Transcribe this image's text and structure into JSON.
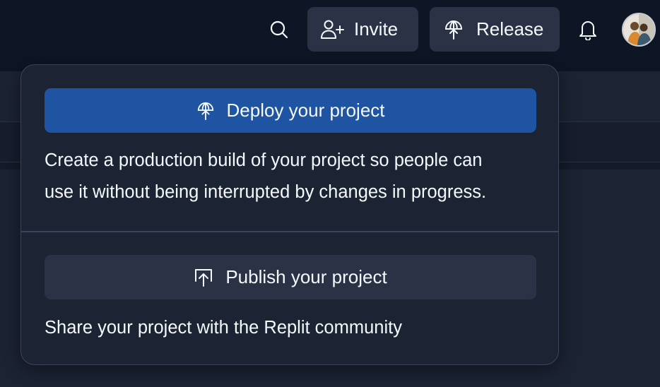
{
  "header": {
    "invite_label": "Invite",
    "release_label": "Release",
    "search_icon": "search-icon",
    "invite_icon": "add-user-icon",
    "release_icon": "deploy-icon",
    "notifications_icon": "bell-icon"
  },
  "release_menu": {
    "deploy": {
      "label": "Deploy your project",
      "description_line1": "Create a production build of your project so people can",
      "description_line2": "use it without being interrupted by changes in progress."
    },
    "publish": {
      "label": "Publish your project",
      "description": "Share your project with the Replit community"
    }
  },
  "colors": {
    "topbar_bg": "#0e1525",
    "surface": "#1c2333",
    "button_bg": "#2b3245",
    "primary": "#1f54a3",
    "text": "#f5f9fc"
  }
}
